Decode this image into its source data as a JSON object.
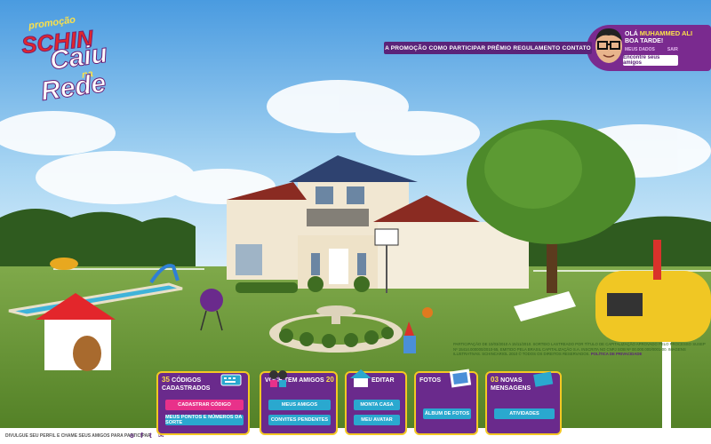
{
  "logo": {
    "promo": "promoção",
    "brand": "SCHIN",
    "line1": "Caiu",
    "na": "na",
    "line2": "Rede"
  },
  "nav": [
    "A PROMOÇÃO",
    "COMO PARTICIPAR",
    "PRÊMIO",
    "REGULAMENTO",
    "CONTATO"
  ],
  "user": {
    "greeting": "OLÁ",
    "name": "MUHAMMED ALI",
    "salutation": "BOA TARDE!",
    "link_a": "MEUS DADOS",
    "link_b": "SAIR",
    "find_friends": "Encontre seus amigos"
  },
  "panels": [
    {
      "count": "35",
      "title": "CÓDIGOS CADASTRADOS",
      "buttons": [
        "CADASTRAR CÓDIGO",
        "MEUS PONTOS E NÚMEROS DA SORTE"
      ]
    },
    {
      "count": "20",
      "title": "VOCÊ TEM AMIGOS",
      "buttons": [
        "MEUS AMIGOS",
        "CONVITES PENDENTES"
      ]
    },
    {
      "count": "",
      "title": "EDITAR",
      "buttons": [
        "MONTA CASA",
        "MEU AVATAR"
      ]
    },
    {
      "count": "",
      "title": "FOTOS",
      "buttons": [
        "ÁLBUM DE FOTOS"
      ]
    },
    {
      "count": "03",
      "title": "NOVAS MENSAGENS",
      "buttons": [
        "ATIVIDADES"
      ]
    }
  ],
  "legal": "Participação de 10/03/2010 a 15/11/2010. Sorteio lastreado por título de capitalização aprovado pelo processo SUSEP nº 15414.000000/2010-55, emitido pela Brasil Capitalização S.A. inscrita no CNPJ sob nº 00.000.000/0001-00. Imagens ilustrativas. Schincariol 2010 © Todos os direitos reservados.",
  "legal_link": "POLÍTICA DE PRIVACIDADE",
  "footer": {
    "invite": "DIVULGUE SEU PERFIL E CHAME SEUS AMIGOS PARA PARTICIPAR",
    "social": [
      "o",
      "f",
      "t",
      "✉"
    ]
  }
}
